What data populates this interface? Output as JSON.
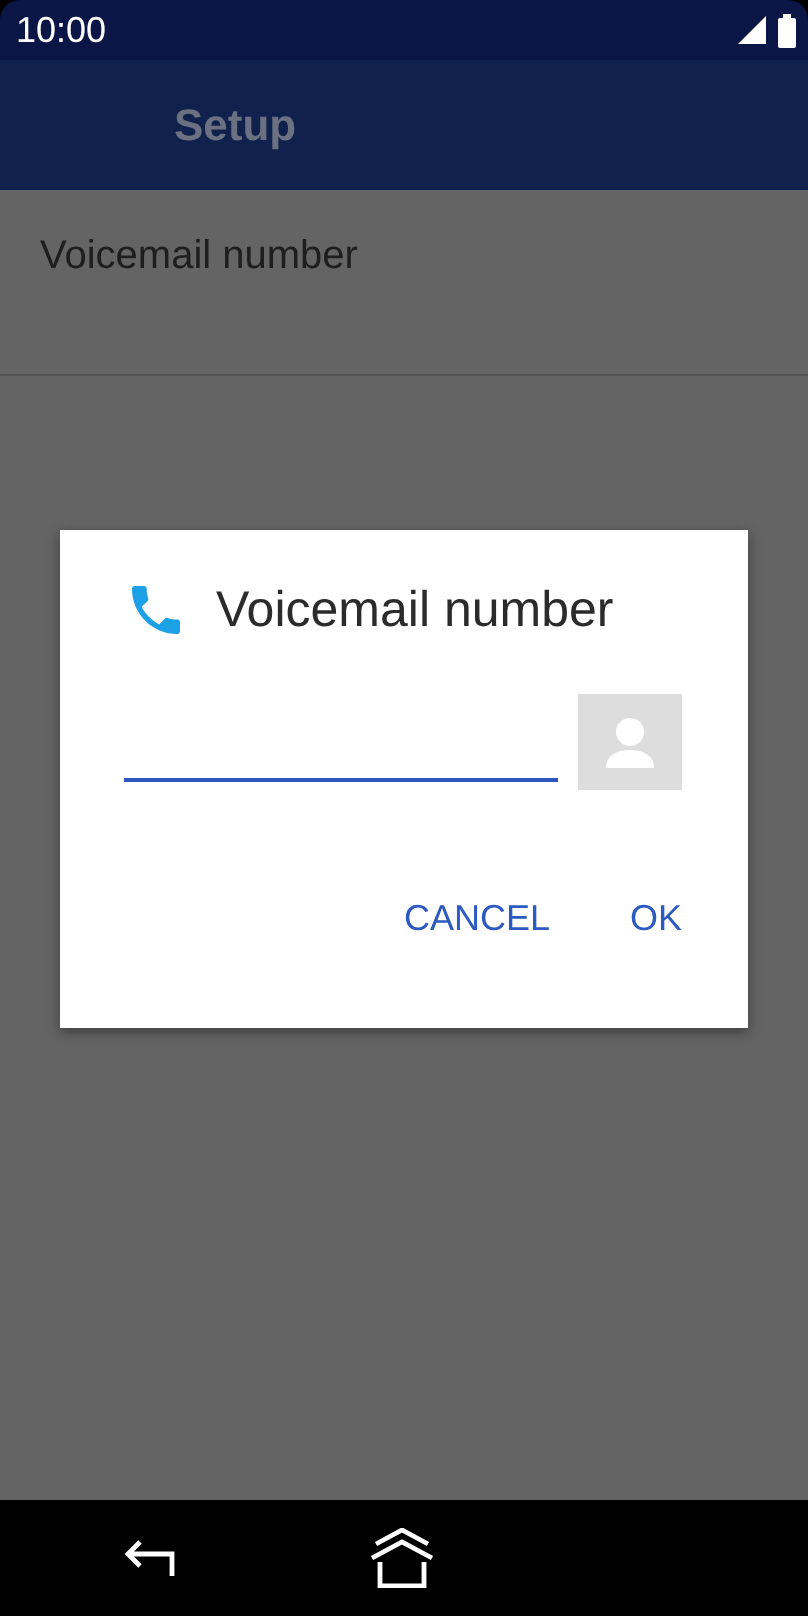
{
  "status_bar": {
    "time": "10:00"
  },
  "app_bar": {
    "title": "Setup"
  },
  "list": [
    {
      "label": "Voicemail number"
    }
  ],
  "dialog": {
    "title": "Voicemail number",
    "buttons": [
      "CANCEL",
      "OK"
    ]
  }
}
